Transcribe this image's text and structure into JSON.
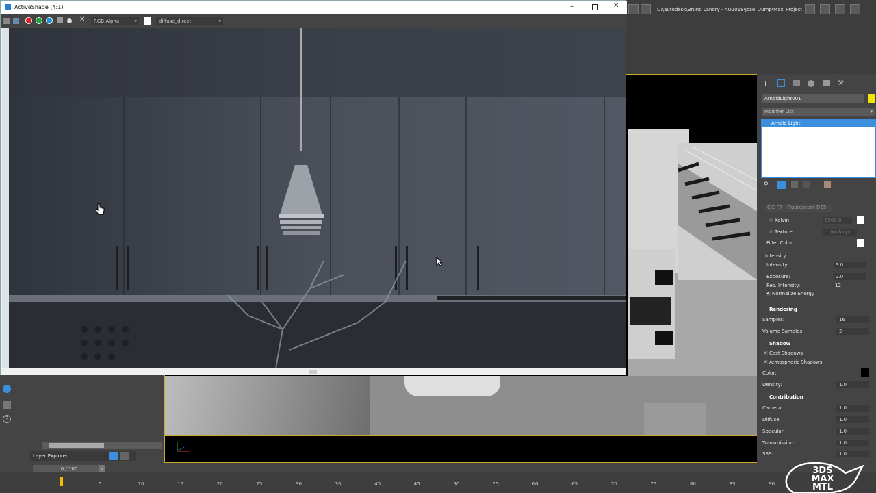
{
  "activeshade": {
    "title": "ActiveShade (4:1)",
    "channel_display": "RGB Alpha",
    "render_element": "diffuse_direct"
  },
  "max": {
    "project_path": "D:\\autodesk\\Bruno Landry - AU2018\\Jose_Dump\\Max_Project"
  },
  "command_panel": {
    "object_name": "ArnoldLight001",
    "modifier_list_label": "Modifier List",
    "stack_item": "Arnold Light",
    "preset": "CIE F7 - Fluorescent D65",
    "kelvin_label": "Kelvin",
    "kelvin_value": "6500.0",
    "texture_label": "Texture",
    "texture_value": "No Map",
    "filter_color_label": "Filter Color:",
    "intensity_group": "Intensity",
    "intensity_label": "Intensity:",
    "intensity_value": "3.0",
    "exposure_label": "Exposure:",
    "exposure_value": "2.0",
    "res_intensity_label": "Res. Intensity:",
    "res_intensity_value": "12",
    "normalize_label": "Normalize Energy",
    "rendering_head": "Rendering",
    "samples_label": "Samples:",
    "samples_value": "16",
    "volume_samples_label": "Volume Samples:",
    "volume_samples_value": "2",
    "shadow_head": "Shadow",
    "cast_shadows_label": "Cast Shadows",
    "atmo_shadows_label": "Atmospheric Shadows",
    "color_label": "Color:",
    "density_label": "Density:",
    "density_value": "1.0",
    "contribution_head": "Contribution",
    "camera_label": "Camera:",
    "camera_value": "1.0",
    "diffuse_label": "Diffuse:",
    "diffuse_value": "1.0",
    "specular_label": "Specular:",
    "specular_value": "1.0",
    "transmission_label": "Transmission:",
    "transmission_value": "1.0",
    "sss_label": "SSS:",
    "sss_value": "1.0"
  },
  "left_dock": {
    "layer_explorer": "Layer Explorer",
    "frame_counter": "0 / 100"
  },
  "timeline": {
    "ticks": [
      "5",
      "10",
      "15",
      "20",
      "25",
      "30",
      "35",
      "40",
      "45",
      "50",
      "55",
      "60",
      "65",
      "70",
      "75",
      "80",
      "85",
      "90"
    ]
  },
  "watermark": {
    "line1": "3DS",
    "line2": "MAX",
    "line3": "MTL"
  },
  "colors": {
    "accent_selection": "#3b8fde",
    "object_color": "#f2e500",
    "viewport_border": "#c9a92a"
  }
}
